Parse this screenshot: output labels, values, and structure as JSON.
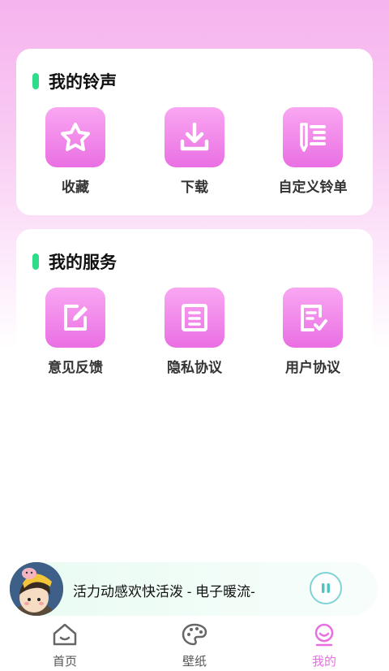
{
  "ringtone_section": {
    "title": "我的铃声",
    "items": [
      {
        "label": "收藏",
        "icon": "star-icon"
      },
      {
        "label": "下载",
        "icon": "download-icon"
      },
      {
        "label": "自定义铃单",
        "icon": "custom-list-icon"
      }
    ]
  },
  "service_section": {
    "title": "我的服务",
    "items": [
      {
        "label": "意见反馈",
        "icon": "edit-icon"
      },
      {
        "label": "隐私协议",
        "icon": "document-icon"
      },
      {
        "label": "用户协议",
        "icon": "checklist-icon"
      }
    ]
  },
  "player": {
    "song": "活力动感欢快活泼 - 电子暖流-",
    "state_icon": "pause-icon"
  },
  "tabs": [
    {
      "label": "首页",
      "icon": "home-icon",
      "active": false
    },
    {
      "label": "壁纸",
      "icon": "palette-icon",
      "active": false
    },
    {
      "label": "我的",
      "icon": "profile-icon",
      "active": true
    }
  ],
  "colors": {
    "accent": "#e86fe0",
    "title_bar": "#2fdc8a",
    "tile_top": "#f9a7f2",
    "tile_bottom": "#ea6fe3"
  }
}
